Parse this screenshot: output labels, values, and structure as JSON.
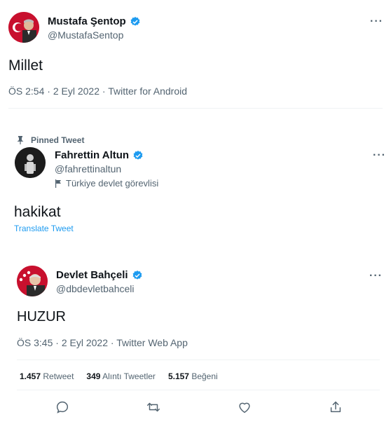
{
  "tweet1": {
    "name": "Mustafa Şentop",
    "handle": "@MustafaSentop",
    "text": "Millet",
    "time": "ÖS 2:54",
    "date": "2 Eyl 2022",
    "source": "Twitter for Android",
    "dot": "·"
  },
  "tweet2": {
    "pinned_label": "Pinned Tweet",
    "name": "Fahrettin Altun",
    "handle": "@fahrettinaltun",
    "affiliation": "Türkiye devlet görevlisi",
    "text": "hakikat",
    "translate": "Translate Tweet"
  },
  "tweet3": {
    "name": "Devlet Bahçeli",
    "handle": "@dbdevletbahceli",
    "text": "HUZUR",
    "time": "ÖS 3:45",
    "date": "2 Eyl 2022",
    "source": "Twitter Web App",
    "dot": "·",
    "stats": {
      "retweets_count": "1.457",
      "retweets_label": "Retweet",
      "quotes_count": "349",
      "quotes_label": "Alıntı Tweetler",
      "likes_count": "5.157",
      "likes_label": "Beğeni"
    }
  },
  "more_glyph": "···",
  "icons": [
    "verified-badge-icon",
    "pin-icon",
    "flag-icon",
    "reply-icon",
    "retweet-icon",
    "like-icon",
    "share-icon"
  ],
  "colors": {
    "accent": "#1d9bf0",
    "text": "#0f1419",
    "muted": "#536471"
  }
}
